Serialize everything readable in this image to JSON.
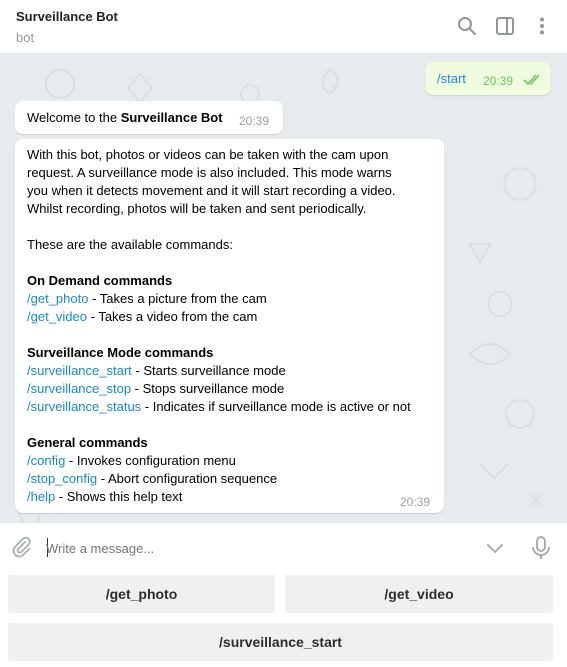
{
  "header": {
    "title": "Surveillance Bot",
    "subtitle": "bot",
    "icons": [
      "search-icon",
      "sidebar-toggle-icon",
      "more-vertical-icon"
    ]
  },
  "messages": {
    "sent": {
      "text": "/start",
      "time": "20:39",
      "status": "read"
    },
    "welcome": {
      "prefix": "Welcome to the ",
      "bold": "Surveillance Bot",
      "time": "20:39"
    },
    "help": {
      "intro": [
        "With this bot, photos or videos can be taken with the cam upon",
        "request. A surveillance mode is also included. This mode warns",
        "you when it detects movement and it will start recording a video.",
        "Whilst recording, photos will be taken and sent periodically."
      ],
      "available": "These are the available commands:",
      "sections": [
        {
          "heading": "On Demand commands",
          "commands": [
            {
              "cmd": "/get_photo",
              "desc": " - Takes a picture from the cam"
            },
            {
              "cmd": "/get_video",
              "desc": " - Takes a video from the cam"
            }
          ]
        },
        {
          "heading": "Surveillance Mode commands",
          "commands": [
            {
              "cmd": "/surveillance_start",
              "desc": " - Starts surveillance mode"
            },
            {
              "cmd": "/surveillance_stop",
              "desc": " - Stops surveillance mode"
            },
            {
              "cmd": "/surveillance_status",
              "desc": " - Indicates if surveillance mode is active or not"
            }
          ]
        },
        {
          "heading": "General commands",
          "commands": [
            {
              "cmd": "/config",
              "desc": " - Invokes configuration menu"
            },
            {
              "cmd": "/stop_config",
              "desc": " - Abort configuration sequence"
            },
            {
              "cmd": "/help",
              "desc": " - Shows this help text"
            }
          ]
        }
      ],
      "time": "20:39"
    }
  },
  "composer": {
    "placeholder": "Write a message..."
  },
  "keyboard": {
    "get_photo": "/get_photo",
    "get_video": "/get_video",
    "surveillance_start": "/surveillance_start"
  },
  "colors": {
    "link": "#168acd",
    "outgoing_bubble": "#effdde",
    "chat_background": "#e6ebee",
    "read_check": "#6cc264"
  }
}
